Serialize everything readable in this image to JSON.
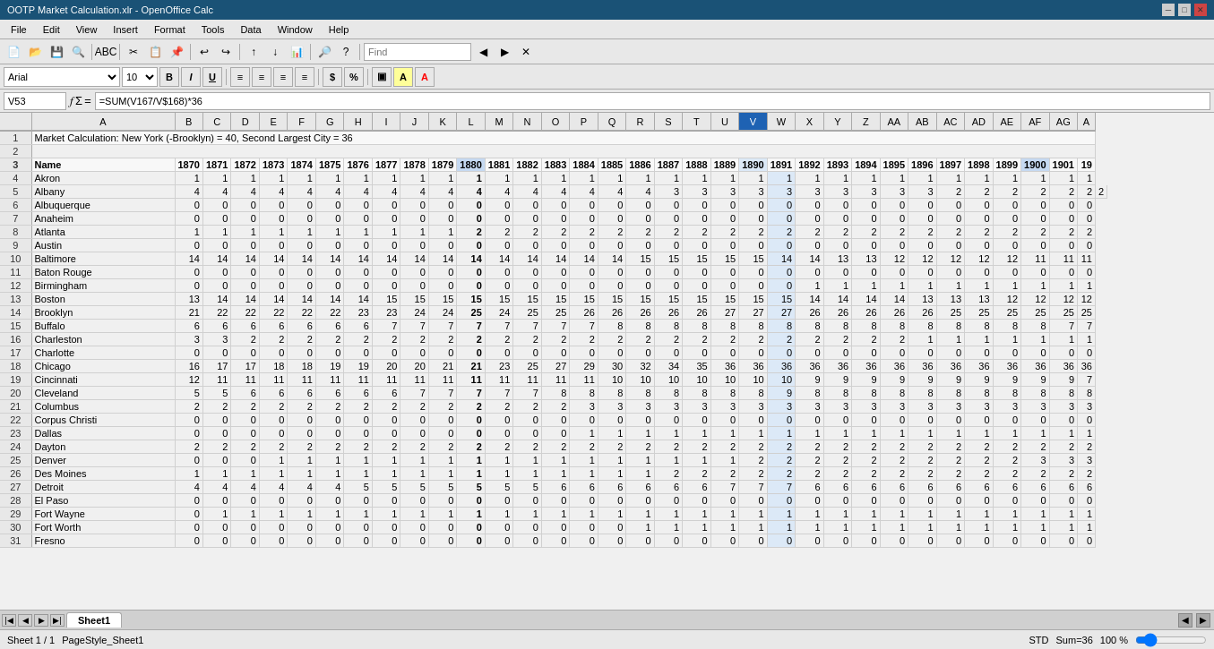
{
  "titlebar": {
    "title": "OOTP Market Calculation.xlr - OpenOffice Calc",
    "controls": [
      "_",
      "□",
      "×"
    ]
  },
  "menubar": {
    "items": [
      "File",
      "Edit",
      "View",
      "Insert",
      "Format",
      "Tools",
      "Data",
      "Window",
      "Help"
    ]
  },
  "formula": {
    "cell_ref": "V53",
    "formula": "=SUM(V167/V$168)*36"
  },
  "header_row1": "Market Calculation: New York (-Brooklyn) = 40, Second Largest City = 36",
  "active_col": "V",
  "col_headers": [
    "",
    "A",
    "B",
    "C",
    "D",
    "E",
    "F",
    "G",
    "H",
    "I",
    "J",
    "K",
    "L",
    "M",
    "N",
    "O",
    "P",
    "Q",
    "R",
    "S",
    "T",
    "U",
    "V",
    "W",
    "X",
    "Y",
    "Z",
    "AA",
    "AB",
    "AC",
    "AD",
    "AE",
    "AF",
    "AG",
    "A"
  ],
  "year_headers": [
    "",
    "Name",
    "1870",
    "1871",
    "1872",
    "1873",
    "1874",
    "1875",
    "1876",
    "1877",
    "1878",
    "1879",
    "1880",
    "1881",
    "1882",
    "1883",
    "1884",
    "1885",
    "1886",
    "1887",
    "1888",
    "1889",
    "1890",
    "1891",
    "1892",
    "1893",
    "1894",
    "1895",
    "1896",
    "1897",
    "1898",
    "1899",
    "1900",
    "1901",
    "19"
  ],
  "cities": [
    {
      "name": "Akron",
      "values": [
        1,
        1,
        1,
        1,
        1,
        1,
        1,
        1,
        1,
        1,
        1,
        1,
        1,
        1,
        1,
        1,
        1,
        1,
        1,
        1,
        1,
        1,
        1,
        1,
        1,
        1,
        1,
        1,
        1,
        1,
        1,
        1,
        1
      ]
    },
    {
      "name": "Albany",
      "values": [
        4,
        4,
        4,
        4,
        4,
        4,
        4,
        4,
        4,
        4,
        4,
        4,
        4,
        4,
        4,
        4,
        4,
        3,
        3,
        3,
        3,
        3,
        3,
        3,
        3,
        3,
        3,
        2,
        2,
        2,
        2,
        2,
        2,
        2
      ]
    },
    {
      "name": "Albuquerque",
      "values": [
        0,
        0,
        0,
        0,
        0,
        0,
        0,
        0,
        0,
        0,
        0,
        0,
        0,
        0,
        0,
        0,
        0,
        0,
        0,
        0,
        0,
        0,
        0,
        0,
        0,
        0,
        0,
        0,
        0,
        0,
        0,
        0,
        0
      ]
    },
    {
      "name": "Anaheim",
      "values": [
        0,
        0,
        0,
        0,
        0,
        0,
        0,
        0,
        0,
        0,
        0,
        0,
        0,
        0,
        0,
        0,
        0,
        0,
        0,
        0,
        0,
        0,
        0,
        0,
        0,
        0,
        0,
        0,
        0,
        0,
        0,
        0,
        0
      ]
    },
    {
      "name": "Atlanta",
      "values": [
        1,
        1,
        1,
        1,
        1,
        1,
        1,
        1,
        1,
        1,
        2,
        2,
        2,
        2,
        2,
        2,
        2,
        2,
        2,
        2,
        2,
        2,
        2,
        2,
        2,
        2,
        2,
        2,
        2,
        2,
        2,
        2,
        2
      ]
    },
    {
      "name": "Austin",
      "values": [
        0,
        0,
        0,
        0,
        0,
        0,
        0,
        0,
        0,
        0,
        0,
        0,
        0,
        0,
        0,
        0,
        0,
        0,
        0,
        0,
        0,
        0,
        0,
        0,
        0,
        0,
        0,
        0,
        0,
        0,
        0,
        0,
        0
      ]
    },
    {
      "name": "Baltimore",
      "values": [
        14,
        14,
        14,
        14,
        14,
        14,
        14,
        14,
        14,
        14,
        14,
        14,
        14,
        14,
        14,
        14,
        15,
        15,
        15,
        15,
        15,
        14,
        14,
        13,
        13,
        12,
        12,
        12,
        12,
        12,
        11,
        11,
        11
      ]
    },
    {
      "name": "Baton Rouge",
      "values": [
        0,
        0,
        0,
        0,
        0,
        0,
        0,
        0,
        0,
        0,
        0,
        0,
        0,
        0,
        0,
        0,
        0,
        0,
        0,
        0,
        0,
        0,
        0,
        0,
        0,
        0,
        0,
        0,
        0,
        0,
        0,
        0,
        0
      ]
    },
    {
      "name": "Birmingham",
      "values": [
        0,
        0,
        0,
        0,
        0,
        0,
        0,
        0,
        0,
        0,
        0,
        0,
        0,
        0,
        0,
        0,
        0,
        0,
        0,
        0,
        0,
        0,
        1,
        1,
        1,
        1,
        1,
        1,
        1,
        1,
        1,
        1,
        1
      ]
    },
    {
      "name": "Boston",
      "values": [
        13,
        14,
        14,
        14,
        14,
        14,
        14,
        15,
        15,
        15,
        15,
        15,
        15,
        15,
        15,
        15,
        15,
        15,
        15,
        15,
        15,
        15,
        14,
        14,
        14,
        14,
        13,
        13,
        13,
        12,
        12,
        12,
        12
      ]
    },
    {
      "name": "Brooklyn",
      "values": [
        21,
        22,
        22,
        22,
        22,
        22,
        23,
        23,
        24,
        24,
        25,
        24,
        25,
        25,
        26,
        26,
        26,
        26,
        26,
        27,
        27,
        27,
        26,
        26,
        26,
        26,
        26,
        25,
        25,
        25,
        25,
        25,
        25
      ]
    },
    {
      "name": "Buffalo",
      "values": [
        6,
        6,
        6,
        6,
        6,
        6,
        6,
        7,
        7,
        7,
        7,
        7,
        7,
        7,
        7,
        8,
        8,
        8,
        8,
        8,
        8,
        8,
        8,
        8,
        8,
        8,
        8,
        8,
        8,
        8,
        8,
        7,
        7
      ]
    },
    {
      "name": "Charleston",
      "values": [
        3,
        3,
        2,
        2,
        2,
        2,
        2,
        2,
        2,
        2,
        2,
        2,
        2,
        2,
        2,
        2,
        2,
        2,
        2,
        2,
        2,
        2,
        2,
        2,
        2,
        2,
        1,
        1,
        1,
        1,
        1,
        1,
        1
      ]
    },
    {
      "name": "Charlotte",
      "values": [
        0,
        0,
        0,
        0,
        0,
        0,
        0,
        0,
        0,
        0,
        0,
        0,
        0,
        0,
        0,
        0,
        0,
        0,
        0,
        0,
        0,
        0,
        0,
        0,
        0,
        0,
        0,
        0,
        0,
        0,
        0,
        0,
        0
      ]
    },
    {
      "name": "Chicago",
      "values": [
        16,
        17,
        17,
        18,
        18,
        19,
        19,
        20,
        20,
        21,
        21,
        23,
        25,
        27,
        29,
        30,
        32,
        34,
        35,
        36,
        36,
        36,
        36,
        36,
        36,
        36,
        36,
        36,
        36,
        36,
        36,
        36,
        36
      ]
    },
    {
      "name": "Cincinnati",
      "values": [
        12,
        11,
        11,
        11,
        11,
        11,
        11,
        11,
        11,
        11,
        11,
        11,
        11,
        11,
        11,
        10,
        10,
        10,
        10,
        10,
        10,
        10,
        9,
        9,
        9,
        9,
        9,
        9,
        9,
        9,
        9,
        9,
        7
      ]
    },
    {
      "name": "Cleveland",
      "values": [
        5,
        5,
        6,
        6,
        6,
        6,
        6,
        6,
        7,
        7,
        7,
        7,
        7,
        8,
        8,
        8,
        8,
        8,
        8,
        8,
        8,
        9,
        8,
        8,
        8,
        8,
        8,
        8,
        8,
        8,
        8,
        8,
        8
      ]
    },
    {
      "name": "Columbus",
      "values": [
        2,
        2,
        2,
        2,
        2,
        2,
        2,
        2,
        2,
        2,
        2,
        2,
        2,
        2,
        3,
        3,
        3,
        3,
        3,
        3,
        3,
        3,
        3,
        3,
        3,
        3,
        3,
        3,
        3,
        3,
        3,
        3,
        3
      ]
    },
    {
      "name": "Corpus Christi",
      "values": [
        0,
        0,
        0,
        0,
        0,
        0,
        0,
        0,
        0,
        0,
        0,
        0,
        0,
        0,
        0,
        0,
        0,
        0,
        0,
        0,
        0,
        0,
        0,
        0,
        0,
        0,
        0,
        0,
        0,
        0,
        0,
        0,
        0
      ]
    },
    {
      "name": "Dallas",
      "values": [
        0,
        0,
        0,
        0,
        0,
        0,
        0,
        0,
        0,
        0,
        0,
        0,
        0,
        0,
        1,
        1,
        1,
        1,
        1,
        1,
        1,
        1,
        1,
        1,
        1,
        1,
        1,
        1,
        1,
        1,
        1,
        1,
        1
      ]
    },
    {
      "name": "Dayton",
      "values": [
        2,
        2,
        2,
        2,
        2,
        2,
        2,
        2,
        2,
        2,
        2,
        2,
        2,
        2,
        2,
        2,
        2,
        2,
        2,
        2,
        2,
        2,
        2,
        2,
        2,
        2,
        2,
        2,
        2,
        2,
        2,
        2,
        2
      ]
    },
    {
      "name": "Denver",
      "values": [
        0,
        0,
        0,
        1,
        1,
        1,
        1,
        1,
        1,
        1,
        1,
        1,
        1,
        1,
        1,
        1,
        1,
        1,
        1,
        1,
        2,
        2,
        2,
        2,
        2,
        2,
        2,
        2,
        2,
        2,
        3,
        3,
        3
      ]
    },
    {
      "name": "Des Moines",
      "values": [
        1,
        1,
        1,
        1,
        1,
        1,
        1,
        1,
        1,
        1,
        1,
        1,
        1,
        1,
        1,
        1,
        1,
        2,
        2,
        2,
        2,
        2,
        2,
        2,
        2,
        2,
        2,
        2,
        2,
        2,
        2,
        2,
        2
      ]
    },
    {
      "name": "Detroit",
      "values": [
        4,
        4,
        4,
        4,
        4,
        4,
        5,
        5,
        5,
        5,
        5,
        5,
        5,
        6,
        6,
        6,
        6,
        6,
        6,
        7,
        7,
        7,
        6,
        6,
        6,
        6,
        6,
        6,
        6,
        6,
        6,
        6,
        6
      ]
    },
    {
      "name": "El Paso",
      "values": [
        0,
        0,
        0,
        0,
        0,
        0,
        0,
        0,
        0,
        0,
        0,
        0,
        0,
        0,
        0,
        0,
        0,
        0,
        0,
        0,
        0,
        0,
        0,
        0,
        0,
        0,
        0,
        0,
        0,
        0,
        0,
        0,
        0
      ]
    },
    {
      "name": "Fort Wayne",
      "values": [
        0,
        1,
        1,
        1,
        1,
        1,
        1,
        1,
        1,
        1,
        1,
        1,
        1,
        1,
        1,
        1,
        1,
        1,
        1,
        1,
        1,
        1,
        1,
        1,
        1,
        1,
        1,
        1,
        1,
        1,
        1,
        1,
        1
      ]
    },
    {
      "name": "Fort Worth",
      "values": [
        0,
        0,
        0,
        0,
        0,
        0,
        0,
        0,
        0,
        0,
        0,
        0,
        0,
        0,
        0,
        0,
        1,
        1,
        1,
        1,
        1,
        1,
        1,
        1,
        1,
        1,
        1,
        1,
        1,
        1,
        1,
        1,
        1
      ]
    },
    {
      "name": "Fresno",
      "values": [
        0,
        0,
        0,
        0,
        0,
        0,
        0,
        0,
        0,
        0,
        0,
        0,
        0,
        0,
        0,
        0,
        0,
        0,
        0,
        0,
        0,
        0,
        0,
        0,
        0,
        0,
        0,
        0,
        0,
        0,
        0,
        0,
        0
      ]
    }
  ],
  "status": {
    "sheet": "Sheet 1 / 1",
    "pagestyle": "PageStyle_Sheet1",
    "mode": "STD",
    "sum": "Sum=36",
    "zoom": "100 %"
  },
  "tabs": [
    "Sheet1"
  ],
  "font": {
    "name": "Arial",
    "size": "10"
  }
}
